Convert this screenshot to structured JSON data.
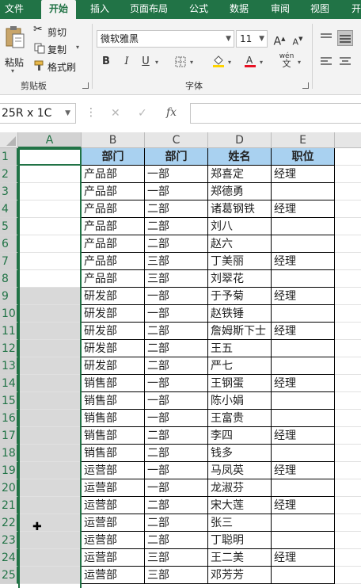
{
  "ribbon_tabs": [
    "文件",
    "开始",
    "插入",
    "页面布局",
    "公式",
    "数据",
    "审阅",
    "视图",
    "开"
  ],
  "active_tab": "开始",
  "clipboard": {
    "paste": "粘贴",
    "cut": "剪切",
    "copy": "复制",
    "format_painter": "格式刷",
    "group_label": "剪贴板"
  },
  "font": {
    "name": "微软雅黑",
    "size": "11",
    "group_label": "字体",
    "bold": "B",
    "italic": "I",
    "underline": "U",
    "grow": "A",
    "shrink": "A",
    "wen": "wén"
  },
  "name_box": "25R x 1C",
  "formula_buttons": {
    "cancel": "✕",
    "enter": "✓",
    "fx": "fx"
  },
  "formula_value": "",
  "columns": [
    "A",
    "B",
    "C",
    "D",
    "E"
  ],
  "rows": [
    "1",
    "2",
    "3",
    "4",
    "5",
    "6",
    "7",
    "8",
    "9",
    "10",
    "11",
    "12",
    "13",
    "14",
    "15",
    "16",
    "17",
    "18",
    "19",
    "20",
    "21",
    "22",
    "23",
    "24",
    "25"
  ],
  "table_header": [
    "部门",
    "部门",
    "姓名",
    "职位"
  ],
  "table_rows": [
    [
      "产品部",
      "一部",
      "郑喜定",
      "经理"
    ],
    [
      "产品部",
      "一部",
      "郑德勇",
      ""
    ],
    [
      "产品部",
      "二部",
      "诸葛钢铁",
      "经理"
    ],
    [
      "产品部",
      "二部",
      "刘八",
      ""
    ],
    [
      "产品部",
      "二部",
      "赵六",
      ""
    ],
    [
      "产品部",
      "三部",
      "丁美丽",
      "经理"
    ],
    [
      "产品部",
      "三部",
      "刘翠花",
      ""
    ],
    [
      "研发部",
      "一部",
      "于予菊",
      "经理"
    ],
    [
      "研发部",
      "一部",
      "赵铁锤",
      ""
    ],
    [
      "研发部",
      "二部",
      "詹姆斯下士",
      "经理"
    ],
    [
      "研发部",
      "二部",
      "王五",
      ""
    ],
    [
      "研发部",
      "二部",
      "严七",
      ""
    ],
    [
      "销售部",
      "一部",
      "王钢蛋",
      "经理"
    ],
    [
      "销售部",
      "一部",
      "陈小娟",
      ""
    ],
    [
      "销售部",
      "一部",
      "王富贵",
      ""
    ],
    [
      "销售部",
      "二部",
      "李四",
      "经理"
    ],
    [
      "销售部",
      "二部",
      "钱多",
      ""
    ],
    [
      "运营部",
      "一部",
      "马凤英",
      "经理"
    ],
    [
      "运营部",
      "一部",
      "龙淑芬",
      ""
    ],
    [
      "运营部",
      "二部",
      "宋大莲",
      "经理"
    ],
    [
      "运营部",
      "二部",
      "张三",
      ""
    ],
    [
      "运营部",
      "二部",
      "丁聪明",
      ""
    ],
    [
      "运营部",
      "三部",
      "王二美",
      "经理"
    ],
    [
      "运营部",
      "三部",
      "邓芳芳",
      ""
    ]
  ],
  "colors": {
    "accent": "#217346",
    "header_fill": "#a9d1f0",
    "selection_fill": "#d9d9d9"
  }
}
